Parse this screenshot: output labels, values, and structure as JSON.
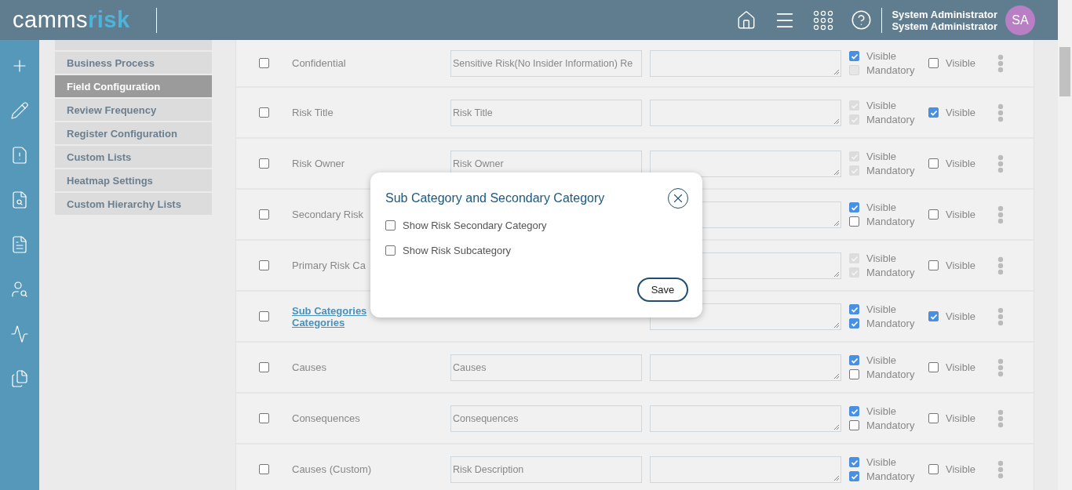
{
  "header": {
    "logo": [
      "camms",
      "risk"
    ],
    "user": {
      "name": "System Administrator",
      "role": "System Administrator",
      "initials": "SA"
    }
  },
  "rail": [
    {
      "kind": "plus"
    },
    {
      "kind": "pencil"
    },
    {
      "kind": "doc-warning"
    },
    {
      "kind": "doc-search"
    },
    {
      "kind": "doc-fire"
    },
    {
      "kind": "user-search"
    },
    {
      "kind": "trend"
    },
    {
      "kind": "docs"
    }
  ],
  "submenu": [
    {
      "label": "Business Process",
      "selected": false
    },
    {
      "label": "Field Configuration",
      "selected": true
    },
    {
      "label": "Review Frequency",
      "selected": false
    },
    {
      "label": "Register Configuration",
      "selected": false
    },
    {
      "label": "Custom Lists",
      "selected": false
    },
    {
      "label": "Heatmap Settings",
      "selected": false
    },
    {
      "label": "Custom Hierarchy Lists",
      "selected": false
    }
  ],
  "rows": [
    {
      "checked": false,
      "label": "Confidential",
      "link": false,
      "value": "Sensitive Risk(No Insider Information) Re",
      "options": [
        {
          "label": "Visible",
          "checked": true,
          "disabled": false
        },
        {
          "label": "Mandatory",
          "checked": false,
          "disabled": true
        }
      ],
      "extra": {
        "label": "Visible",
        "checked": false
      }
    },
    {
      "checked": false,
      "label": "Risk Title",
      "link": false,
      "value": "Risk Title",
      "options": [
        {
          "label": "Visible",
          "checked": true,
          "disabled": true
        },
        {
          "label": "Mandatory",
          "checked": true,
          "disabled": true
        }
      ],
      "extra": {
        "label": "Visible",
        "checked": true
      }
    },
    {
      "checked": false,
      "label": "Risk Owner",
      "link": false,
      "value": "Risk Owner",
      "options": [
        {
          "label": "Visible",
          "checked": true,
          "disabled": true
        },
        {
          "label": "Mandatory",
          "checked": true,
          "disabled": true
        }
      ],
      "extra": {
        "label": "Visible",
        "checked": false
      }
    },
    {
      "checked": false,
      "label": "Secondary Risk",
      "link": false,
      "options": [
        {
          "label": "Visible",
          "checked": true,
          "disabled": false
        },
        {
          "label": "Mandatory",
          "checked": false,
          "disabled": false
        }
      ],
      "extra": {
        "label": "Visible",
        "checked": false
      }
    },
    {
      "checked": false,
      "label": "Primary Risk Ca",
      "link": false,
      "options": [
        {
          "label": "Visible",
          "checked": true,
          "disabled": true
        },
        {
          "label": "Mandatory",
          "checked": true,
          "disabled": true
        }
      ],
      "extra": {
        "label": "Visible",
        "checked": false
      }
    },
    {
      "checked": false,
      "label": "Sub Categories\nCategories",
      "link": true,
      "options": [
        {
          "label": "Visible",
          "checked": true,
          "disabled": false
        },
        {
          "label": "Mandatory",
          "checked": true,
          "disabled": false
        }
      ],
      "extra": {
        "label": "Visible",
        "checked": true
      }
    },
    {
      "checked": false,
      "label": "Causes",
      "link": false,
      "value": "Causes",
      "options": [
        {
          "label": "Visible",
          "checked": true,
          "disabled": false
        },
        {
          "label": "Mandatory",
          "checked": false,
          "disabled": false
        }
      ],
      "extra": {
        "label": "Visible",
        "checked": false
      }
    },
    {
      "checked": false,
      "label": "Consequences",
      "link": false,
      "value": "Consequences",
      "options": [
        {
          "label": "Visible",
          "checked": true,
          "disabled": false
        },
        {
          "label": "Mandatory",
          "checked": false,
          "disabled": false
        }
      ],
      "extra": {
        "label": "Visible",
        "checked": false
      }
    },
    {
      "checked": false,
      "label": "Causes (Custom)",
      "link": false,
      "value": "Risk Description",
      "options": [
        {
          "label": "Visible",
          "checked": true,
          "disabled": false
        },
        {
          "label": "Mandatory",
          "checked": true,
          "disabled": false
        }
      ],
      "extra": {
        "label": "Visible",
        "checked": false
      }
    }
  ],
  "dialog": {
    "title": "Sub Category and Secondary Category",
    "options": [
      {
        "label": "Show Risk Secondary Category",
        "checked": false
      },
      {
        "label": "Show Risk Subcategory",
        "checked": false
      }
    ],
    "button": "Save"
  }
}
